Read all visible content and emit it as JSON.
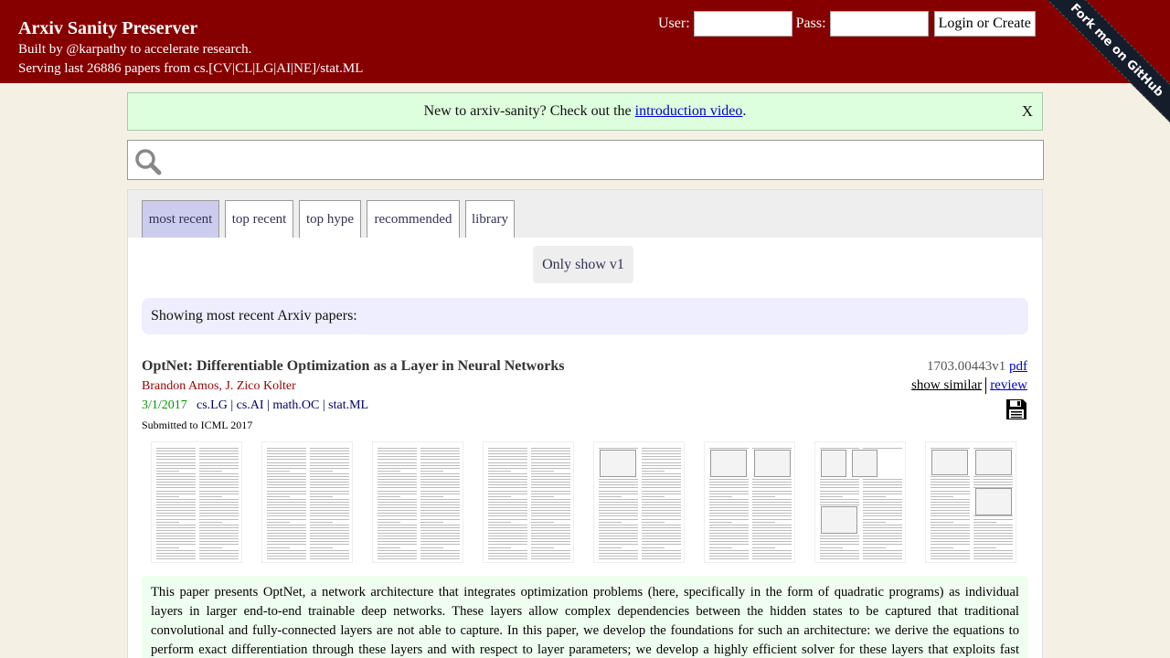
{
  "header": {
    "title": "Arxiv Sanity Preserver",
    "subtitle1": "Built by @karpathy to accelerate research.",
    "subtitle2": "Serving last 26886 papers from cs.[CV|CL|LG|AI|NE]/stat.ML",
    "user_label": "User:",
    "pass_label": "Pass:",
    "login_button": "Login or Create",
    "ribbon": "Fork me on GitHub"
  },
  "notice": {
    "text_before": "New to arxiv-sanity? Check out the ",
    "link": "introduction video",
    "text_after": ".",
    "close": "X"
  },
  "search": {
    "value": "",
    "placeholder": ""
  },
  "tabs": [
    {
      "label": "most recent",
      "active": true
    },
    {
      "label": "top recent",
      "active": false
    },
    {
      "label": "top hype",
      "active": false
    },
    {
      "label": "recommended",
      "active": false
    },
    {
      "label": "library",
      "active": false
    }
  ],
  "v1_button": "Only show v1",
  "showing_text": "Showing most recent Arxiv papers:",
  "paper": {
    "title": "OptNet: Differentiable Optimization as a Layer in Neural Networks",
    "authors": [
      "Brandon Amos",
      "J. Zico Kolter"
    ],
    "date": "3/1/2017",
    "categories": [
      "cs.LG",
      "cs.AI",
      "math.OC",
      "stat.ML"
    ],
    "comment": "Submitted to ICML 2017",
    "id": "1703.00443v1",
    "pdf": "pdf",
    "show_similar": "show similar",
    "review": "review",
    "save_icon": "floppy-disk-icon",
    "abstract": "This paper presents OptNet, a network architecture that integrates optimization problems (here, specifically in the form of quadratic programs) as individual layers in larger end-to-end trainable deep networks. These layers allow complex dependencies between the hidden states to be captured that traditional convolutional and fully-connected layers are not able to capture. In this paper, we develop the foundations for such an architecture: we derive the equations to perform exact differentiation through these layers and with respect to layer parameters; we develop a highly efficient solver for these layers that exploits fast GPU-based batch solves within a primal-dual interior point method, and which provides backpropagation gradients with virtually no additional cost on top of the solve; and we highlight the application"
  },
  "colors": {
    "header_bg": "#860000",
    "page_bg": "#f4f1e4",
    "notice_bg": "#ddffdd",
    "active_tab": "#ccccee",
    "author": "#990000",
    "date": "#009900"
  }
}
